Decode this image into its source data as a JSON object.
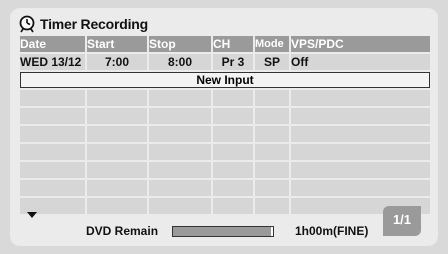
{
  "title": "Timer Recording",
  "icons": {
    "clock": "clock-icon",
    "scroll_up": "triangle-up",
    "scroll_down": "triangle-down"
  },
  "columns": [
    "Date",
    "Start",
    "Stop",
    "CH",
    "Mode",
    "VPS/PDC"
  ],
  "entries": [
    {
      "date": "WED 13/12",
      "start": "7:00",
      "stop": "8:00",
      "ch": "Pr 3",
      "mode": "SP",
      "vps": "Off"
    }
  ],
  "new_input_label": "New Input",
  "footer": {
    "remain_label": "DVD Remain",
    "remain_fraction": 0.98,
    "remain_time": "1h00m(FINE)",
    "page_indicator": "1/1"
  },
  "colors": {
    "header_bg": "#9a9a9a",
    "row_bg": "#d6d6d6",
    "panel_bg": "#ebebeb"
  }
}
